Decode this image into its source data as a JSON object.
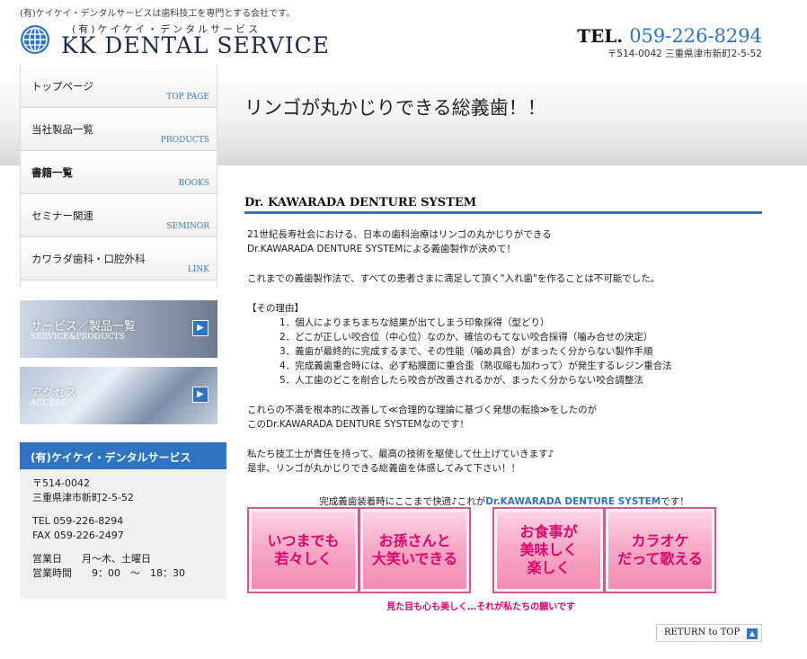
{
  "header": {
    "tagline": "(有)ケイケイ・デンタルサービスは歯科技工を専門とする会社です。",
    "logo_sub": "(有)ケイケイ・デンタルサービス",
    "logo_main": "KK DENTAL SERVICE",
    "tel_label": "TEL.",
    "tel_number": "059-226-8294",
    "address": "〒514-0042 三重県津市新町2-5-52"
  },
  "hero": {
    "title": "リンゴが丸かじりできる総義歯！！"
  },
  "sidebar": {
    "items": [
      {
        "ja": "トップページ",
        "en": "TOP PAGE"
      },
      {
        "ja": "当社製品一覧",
        "en": "PRODUCTS"
      },
      {
        "ja": "書籍一覧",
        "en": "BOOKS"
      },
      {
        "ja": "セミナー関連",
        "en": "SEMINOR"
      },
      {
        "ja": "カワラダ歯科・口腔外科",
        "en": "LINK"
      }
    ],
    "banners": [
      {
        "label": "サービス／製品一覧",
        "sub": "SERVICE&PRODUCTS"
      },
      {
        "label": "アクセス",
        "sub": "ACCESS"
      }
    ]
  },
  "company": {
    "name": "(有)ケイケイ・デンタルサービス",
    "zip": "〒514-0042",
    "address": "三重県津市新町2-5-52",
    "tel": "TEL 059-226-8294",
    "fax": "FAX 059-226-2497",
    "days": "営業日　　月～木、土曜日",
    "hours": "営業時間　　9：00　～　18：30"
  },
  "main": {
    "section_title": "Dr. KAWARADA DENTURE SYSTEM",
    "intro1": "21世紀長寿社会における、日本の歯科治療はリンゴの丸かじりができる",
    "intro2": "Dr.KAWARADA DENTURE SYSTEMによる義歯製作が決めて！",
    "para2": "これまでの義歯製作法で、すべての患者さまに満足して頂く\"入れ歯\"を作ることは不可能でした。",
    "reason_head": "【その理由】",
    "reasons": [
      "1．個人によりまちまちな結果が出てしまう印象採得（型どり）",
      "2．どこが正しい咬合位（中心位）なのか、確信のもてない咬合採得（噛み合せの決定）",
      "3．義歯が最終的に完成するまで、その性能（噛め具合）がまったく分からない製作手順",
      "4．完成義歯重合時には、必ず粘膜面に重合歪（熱収縮も加わって）が発生するレジン重合法",
      "5．人工歯のどこを削合したら咬合が改善されるかが、まったく分からない咬合調整法"
    ],
    "para3a": "これらの不満を根本的に改善して≪合理的な理論に基づく発想の転換≫をしたのが",
    "para3b": "このDr.KAWARADA DENTURE SYSTEMなのです！",
    "para4a": "私たち技工士が責任を持って、最高の技術を駆使して仕上げていきます♪",
    "para4b": "是非、リンゴが丸かじりできる総義歯を体感してみて下さい！！",
    "promo_caption_a": "完成義歯装着時にここまで快適♪これが",
    "promo_caption_b": "Dr.KAWARADA DENTURE SYSTEM",
    "promo_caption_c": "です！",
    "promos": [
      "いつまでも\n若々しく",
      "お孫さんと\n大笑いできる",
      "お食事が\n美味しく\n楽しく",
      "カラオケ\nだって歌える"
    ],
    "promo_foot": "見た目も心も美しく…それが私たちの願いです",
    "return_top": "RETURN to TOP"
  },
  "colors": {
    "accent": "#2f74c0",
    "pink": "#e0006e"
  }
}
